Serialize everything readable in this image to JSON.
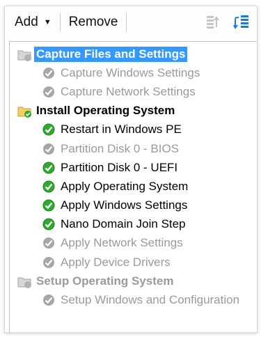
{
  "toolbar": {
    "add_label": "Add",
    "add_arrow": "▼",
    "remove_label": "Remove"
  },
  "tree": {
    "groups": [
      {
        "label": "Capture Files and Settings",
        "icon": "folder-disabled-icon",
        "selected": true,
        "children": [
          {
            "label": "Capture Windows Settings",
            "icon": "check-disabled-icon"
          },
          {
            "label": "Capture Network Settings",
            "icon": "check-disabled-icon"
          }
        ]
      },
      {
        "label": "Install Operating System",
        "icon": "folder-enabled-icon",
        "children": [
          {
            "label": "Restart in Windows PE",
            "icon": "check-success-icon"
          },
          {
            "label": "Partition Disk 0 - BIOS",
            "icon": "check-disabled-icon"
          },
          {
            "label": "Partition Disk 0 - UEFI",
            "icon": "check-success-icon"
          },
          {
            "label": "Apply Operating System",
            "icon": "check-success-icon"
          },
          {
            "label": "Apply Windows Settings",
            "icon": "check-success-icon"
          },
          {
            "label": "Nano Domain Join Step",
            "icon": "check-success-icon"
          },
          {
            "label": "Apply Network Settings",
            "icon": "check-disabled-icon"
          },
          {
            "label": "Apply Device Drivers",
            "icon": "check-disabled-icon"
          }
        ]
      },
      {
        "label": "Setup Operating System",
        "icon": "folder-disabled-icon",
        "children": [
          {
            "label": "Setup Windows and Configuration",
            "icon": "check-disabled-icon"
          }
        ]
      }
    ]
  },
  "colors": {
    "selection": "#3399ff",
    "success_green": "#2eaa2e",
    "disabled_text": "#9a9a9a",
    "disabled_icon": "#a6a6a6",
    "folder_yellow": "#f1cf6a"
  }
}
